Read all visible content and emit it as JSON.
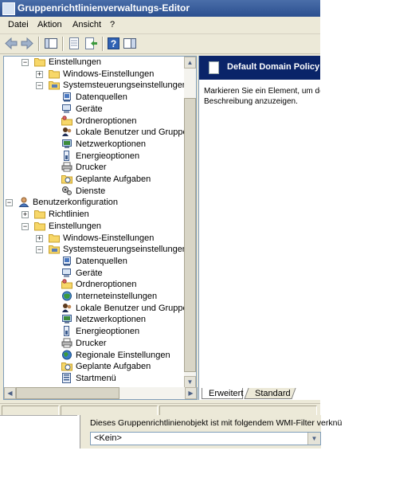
{
  "window": {
    "title": "Gruppenrichtlinienverwaltungs-Editor"
  },
  "menu": [
    "Datei",
    "Aktion",
    "Ansicht",
    "?"
  ],
  "toolbar": {
    "icons": [
      "back-arrow-icon",
      "forward-arrow-icon",
      "show-hide-tree-icon",
      "properties-icon",
      "export-list-icon",
      "help-icon",
      "show-action-pane-icon"
    ]
  },
  "tree": {
    "items": [
      {
        "label": "Einstellungen",
        "level": 1,
        "expander": "−",
        "icon": "folder-icon"
      },
      {
        "label": "Windows-Einstellungen",
        "level": 2,
        "expander": "+",
        "icon": "folder-icon"
      },
      {
        "label": "Systemsteuerungseinstellungen",
        "level": 2,
        "expander": "−",
        "icon": "control-panel-icon"
      },
      {
        "label": "Datenquellen",
        "level": 3,
        "expander": "",
        "icon": "data-sources-icon"
      },
      {
        "label": "Geräte",
        "level": 3,
        "expander": "",
        "icon": "devices-icon"
      },
      {
        "label": "Ordneroptionen",
        "level": 3,
        "expander": "",
        "icon": "folder-options-icon"
      },
      {
        "label": "Lokale Benutzer und Gruppen",
        "level": 3,
        "expander": "",
        "icon": "local-users-groups-icon"
      },
      {
        "label": "Netzwerkoptionen",
        "level": 3,
        "expander": "",
        "icon": "network-options-icon"
      },
      {
        "label": "Energieoptionen",
        "level": 3,
        "expander": "",
        "icon": "power-options-icon"
      },
      {
        "label": "Drucker",
        "level": 3,
        "expander": "",
        "icon": "printer-icon"
      },
      {
        "label": "Geplante Aufgaben",
        "level": 3,
        "expander": "",
        "icon": "scheduled-tasks-icon"
      },
      {
        "label": "Dienste",
        "level": 3,
        "expander": "",
        "icon": "services-icon"
      },
      {
        "label": "Benutzerkonfiguration",
        "level": 0,
        "expander": "−",
        "icon": "user-config-icon"
      },
      {
        "label": "Richtlinien",
        "level": 1,
        "expander": "+",
        "icon": "folder-icon"
      },
      {
        "label": "Einstellungen",
        "level": 1,
        "expander": "−",
        "icon": "folder-icon"
      },
      {
        "label": "Windows-Einstellungen",
        "level": 2,
        "expander": "+",
        "icon": "folder-icon"
      },
      {
        "label": "Systemsteuerungseinstellungen",
        "level": 2,
        "expander": "−",
        "icon": "control-panel-icon"
      },
      {
        "label": "Datenquellen",
        "level": 3,
        "expander": "",
        "icon": "data-sources-icon"
      },
      {
        "label": "Geräte",
        "level": 3,
        "expander": "",
        "icon": "devices-icon"
      },
      {
        "label": "Ordneroptionen",
        "level": 3,
        "expander": "",
        "icon": "folder-options-icon"
      },
      {
        "label": "Interneteinstellungen",
        "level": 3,
        "expander": "",
        "icon": "internet-settings-icon"
      },
      {
        "label": "Lokale Benutzer und Gruppen",
        "level": 3,
        "expander": "",
        "icon": "local-users-groups-icon"
      },
      {
        "label": "Netzwerkoptionen",
        "level": 3,
        "expander": "",
        "icon": "network-options-icon"
      },
      {
        "label": "Energieoptionen",
        "level": 3,
        "expander": "",
        "icon": "power-options-icon"
      },
      {
        "label": "Drucker",
        "level": 3,
        "expander": "",
        "icon": "printer-icon"
      },
      {
        "label": "Regionale Einstellungen",
        "level": 3,
        "expander": "",
        "icon": "regional-settings-icon"
      },
      {
        "label": "Geplante Aufgaben",
        "level": 3,
        "expander": "",
        "icon": "scheduled-tasks-icon"
      },
      {
        "label": "Startmenü",
        "level": 3,
        "expander": "",
        "icon": "start-menu-icon"
      }
    ]
  },
  "right_pane": {
    "header": "Default Domain Policy [",
    "description_line1": "Markieren Sie ein Element, um des",
    "description_line2": "Beschreibung anzuzeigen."
  },
  "tabs": [
    "Erweitert",
    "Standard"
  ],
  "wmi": {
    "label": "Dieses Gruppenrichtlinienobjekt ist mit folgendem WMI-Filter verknü",
    "value": "<Kein>"
  },
  "colors": {
    "title_bar": "#2b4f8f",
    "header_bar": "#0a2469",
    "window_bg": "#ece9d8",
    "folder": "#f7d769"
  }
}
